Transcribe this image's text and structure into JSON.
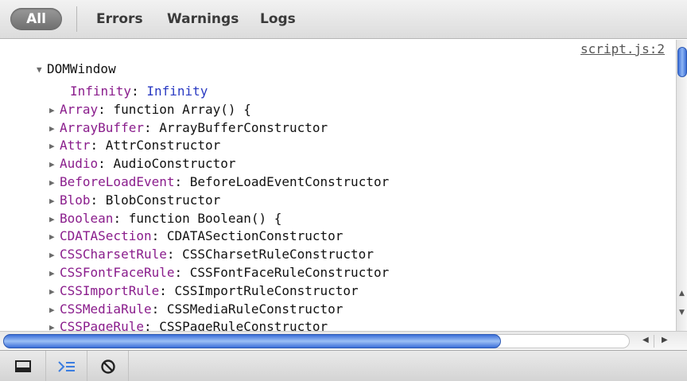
{
  "filters": {
    "all": "All",
    "errors": "Errors",
    "warnings": "Warnings",
    "logs": "Logs"
  },
  "console": {
    "source_link": "script.js:2",
    "root_label": "DOMWindow",
    "properties": [
      {
        "key": "Infinity",
        "value": "Infinity",
        "expandable": false
      },
      {
        "key": "Array",
        "value": "function Array() {",
        "expandable": true
      },
      {
        "key": "ArrayBuffer",
        "value": "ArrayBufferConstructor",
        "expandable": true
      },
      {
        "key": "Attr",
        "value": "AttrConstructor",
        "expandable": true
      },
      {
        "key": "Audio",
        "value": "AudioConstructor",
        "expandable": true
      },
      {
        "key": "BeforeLoadEvent",
        "value": "BeforeLoadEventConstructor",
        "expandable": true
      },
      {
        "key": "Blob",
        "value": "BlobConstructor",
        "expandable": true
      },
      {
        "key": "Boolean",
        "value": "function Boolean() {",
        "expandable": true
      },
      {
        "key": "CDATASection",
        "value": "CDATASectionConstructor",
        "expandable": true
      },
      {
        "key": "CSSCharsetRule",
        "value": "CSSCharsetRuleConstructor",
        "expandable": true
      },
      {
        "key": "CSSFontFaceRule",
        "value": "CSSFontFaceRuleConstructor",
        "expandable": true
      },
      {
        "key": "CSSImportRule",
        "value": "CSSImportRuleConstructor",
        "expandable": true
      },
      {
        "key": "CSSMediaRule",
        "value": "CSSMediaRuleConstructor",
        "expandable": true
      },
      {
        "key": "CSSPageRule",
        "value": "CSSPageRuleConstructor",
        "expandable": true
      }
    ]
  },
  "toolbar": {
    "dock_icon": "dock-window-icon",
    "console_icon": "console-prompt-icon",
    "clear_icon": "clear-console-icon"
  },
  "colors": {
    "accent": "#3b6fd8",
    "property_key": "#8a1d8c",
    "number_value": "#2a3ac2"
  }
}
